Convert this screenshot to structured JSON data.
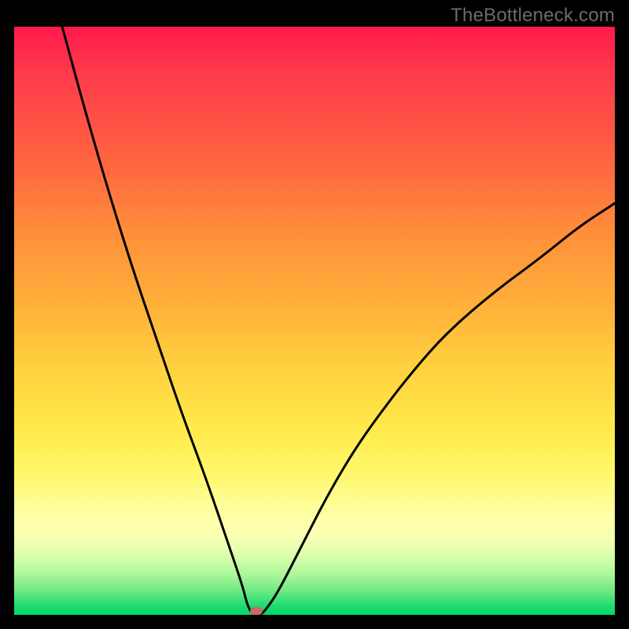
{
  "watermark": "TheBottleneck.com",
  "marker": {
    "x_pct": 40.3,
    "y_pct": 99.4
  },
  "colors": {
    "curve": "#000000",
    "marker": "#c96b63",
    "gradient_top": "#ff1a4b",
    "gradient_bottom": "#00d86a"
  },
  "chart_data": {
    "type": "line",
    "title": "",
    "xlabel": "",
    "ylabel": "",
    "xlim": [
      0,
      100
    ],
    "ylim": [
      0,
      100
    ],
    "grid": false,
    "legend": false,
    "annotations": [
      "TheBottleneck.com"
    ],
    "description": "V-shaped bottleneck curve over a vertical red→green gradient. Minimum (flat bottom) sits near x≈40 at y≈0. Left branch rises steeply toward the top-left corner; right branch rises more gently toward the upper-right, ending near y≈70 at x=100.",
    "series": [
      {
        "name": "bottleneck_curve",
        "x": [
          8,
          12,
          16,
          20,
          24,
          28,
          32,
          36,
          38,
          39,
          40,
          41,
          42,
          44,
          48,
          52,
          56,
          60,
          66,
          72,
          80,
          88,
          94,
          100
        ],
        "y": [
          100,
          85,
          71,
          58,
          46,
          34,
          23,
          11,
          5,
          1,
          0,
          0,
          1,
          4,
          12,
          20,
          27,
          33,
          41,
          48,
          55,
          61,
          66,
          70
        ]
      }
    ],
    "minimum_marker": {
      "x": 40.3,
      "y": 0
    }
  }
}
